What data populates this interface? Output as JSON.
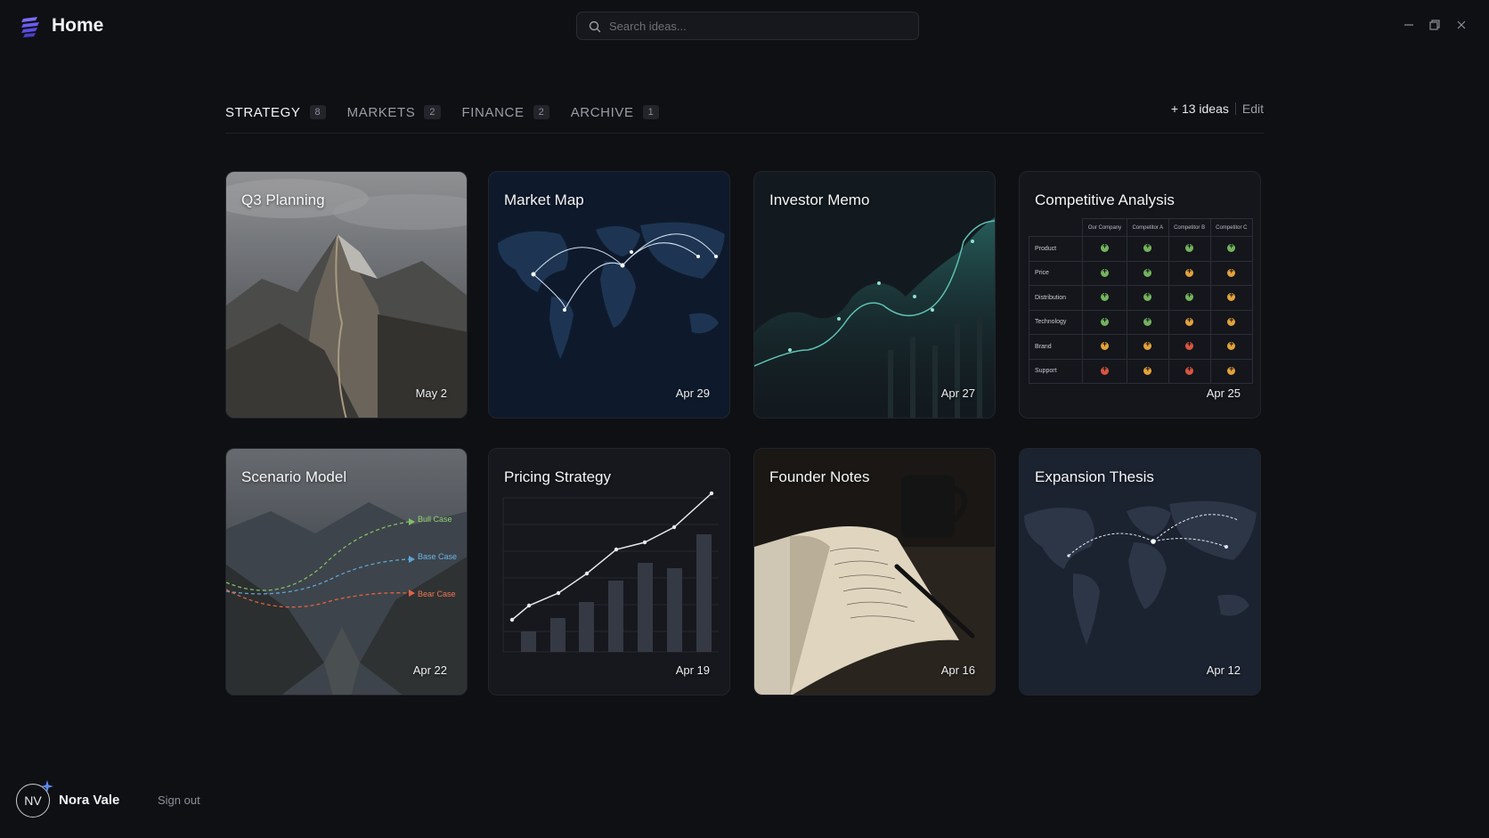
{
  "app": {
    "title": "Home"
  },
  "search": {
    "placeholder": "Search ideas..."
  },
  "tabs": [
    {
      "label": "STRATEGY",
      "count": "8",
      "active": true
    },
    {
      "label": "MARKETS",
      "count": "2"
    },
    {
      "label": "FINANCE",
      "count": "2"
    },
    {
      "label": "ARCHIVE",
      "count": "1"
    }
  ],
  "toolbar": {
    "ideas": "+ 13 ideas",
    "edit": "Edit"
  },
  "cards": [
    {
      "title": "Q3 Planning",
      "date": "May 2"
    },
    {
      "title": "Market Map",
      "date": "Apr 29"
    },
    {
      "title": "Investor Memo",
      "date": "Apr 27"
    },
    {
      "title": "Competitive Analysis",
      "date": "Apr 25"
    },
    {
      "title": "Scenario Model",
      "date": "Apr 22"
    },
    {
      "title": "Pricing Strategy",
      "date": "Apr 19"
    },
    {
      "title": "Founder Notes",
      "date": "Apr 16"
    },
    {
      "title": "Expansion Thesis",
      "date": "Apr 12"
    }
  ],
  "competitive_table": {
    "columns": [
      "Our Company",
      "Competitor A",
      "Competitor B",
      "Competitor C"
    ],
    "rows": [
      {
        "label": "Product",
        "ratings": [
          "good",
          "good",
          "good",
          "good"
        ]
      },
      {
        "label": "Price",
        "ratings": [
          "good",
          "good",
          "fair",
          "fair"
        ]
      },
      {
        "label": "Distribution",
        "ratings": [
          "good",
          "good",
          "good",
          "fair"
        ]
      },
      {
        "label": "Technology",
        "ratings": [
          "good",
          "good",
          "fair",
          "fair"
        ]
      },
      {
        "label": "Brand",
        "ratings": [
          "fair",
          "fair",
          "poor",
          "fair"
        ]
      },
      {
        "label": "Support",
        "ratings": [
          "poor",
          "fair",
          "poor",
          "fair"
        ]
      }
    ]
  },
  "scenarios": {
    "bull": "Bull Case",
    "base": "Base Case",
    "bear": "Bear Case"
  },
  "user": {
    "initials": "NV",
    "name": "Nora Vale",
    "signout": "Sign out"
  },
  "colors": {
    "accent": "#6b5cf0",
    "good": "#74b35c",
    "fair": "#e3a23a",
    "poor": "#d9553e"
  }
}
